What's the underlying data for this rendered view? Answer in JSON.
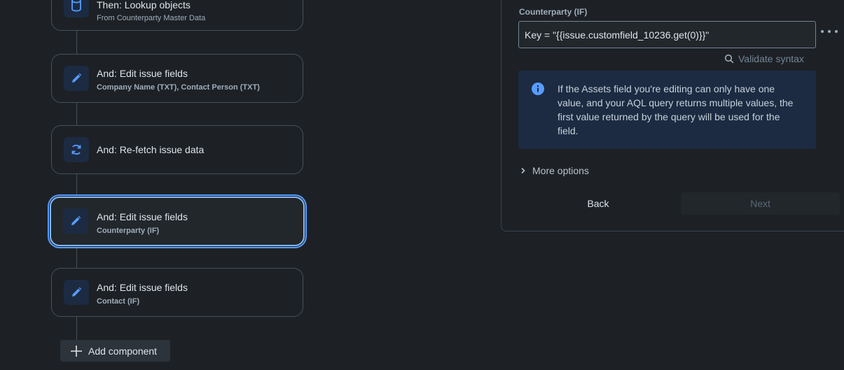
{
  "flow": {
    "cards": [
      {
        "title": "Then: Lookup objects",
        "subtitle": "From Counterparty Master Data",
        "icon": "database-icon"
      },
      {
        "title": "And: Edit issue fields",
        "subtitle": "Company Name (TXT), Contact Person (TXT)",
        "icon": "pencil-icon"
      },
      {
        "title": "And: Re-fetch issue data",
        "icon": "refresh-icon"
      },
      {
        "title": "And: Edit issue fields",
        "subtitle": "Counterparty (IF)",
        "icon": "pencil-icon",
        "selected": true
      },
      {
        "title": "And: Edit issue fields",
        "subtitle": "Contact (IF)",
        "icon": "pencil-icon"
      }
    ],
    "add_component_label": "Add component"
  },
  "panel": {
    "field_label": "Counterparty (IF)",
    "field_value": "Key = \"{{issue.customfield_10236.get(0)}}\"",
    "validate_label": "Validate syntax",
    "info_text": "If the Assets field you're editing can only have one value, and your AQL query returns multiple values, the first value returned by the query will be used for the field.",
    "more_options_label": "More options",
    "back_label": "Back",
    "next_label": "Next"
  },
  "colors": {
    "background": "#1d2125",
    "accent": "#579dff",
    "icon_box": "#1c2b42",
    "info_bg": "#1c2b42"
  }
}
